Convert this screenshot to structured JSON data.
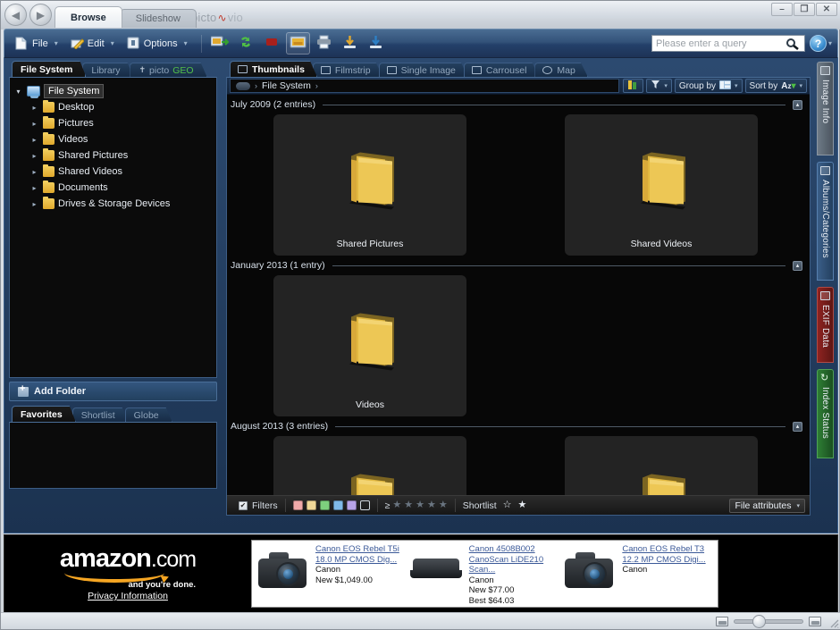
{
  "window": {
    "title": "pictomvio",
    "buttons": {
      "minimize": "–",
      "maximize": "❐",
      "close": "✕"
    }
  },
  "nav": {
    "back": "◀",
    "forward": "▶"
  },
  "app_tabs": [
    {
      "label": "Browse",
      "active": true
    },
    {
      "label": "Slideshow",
      "active": false
    }
  ],
  "brand": {
    "part1": "picto",
    "wave": "\\u223f",
    "part2": "vio"
  },
  "toolbar": {
    "menus": [
      {
        "label": "File",
        "icon": "file-icon",
        "caret": "▾"
      },
      {
        "label": "Edit",
        "icon": "edit-icon",
        "caret": "▾"
      },
      {
        "label": "Options",
        "icon": "options-icon",
        "caret": "▾"
      }
    ],
    "buttons": [
      {
        "name": "export-images-button",
        "icon": "export-images-icon"
      },
      {
        "name": "rotate-button",
        "icon": "rotate-refresh-icon"
      },
      {
        "name": "stop-button",
        "icon": "stop-icon"
      },
      {
        "name": "slideshow-button",
        "icon": "slideshow-icon"
      },
      {
        "name": "print-button",
        "icon": "print-icon"
      },
      {
        "name": "download-button",
        "icon": "download-icon"
      },
      {
        "name": "upload-button",
        "icon": "upload-icon"
      }
    ],
    "search": {
      "placeholder": "Please enter a query",
      "value": "",
      "icon": "search-icon"
    },
    "help": {
      "label": "?",
      "caret": "▾"
    }
  },
  "sidebar": {
    "tabs": [
      {
        "label": "File System",
        "active": true
      },
      {
        "label": "Library",
        "active": false
      },
      {
        "label": "pictoGEO",
        "active": false,
        "geo_suffix": "GEO",
        "prefix": "picto"
      }
    ],
    "tree": [
      {
        "label": "File System",
        "icon": "computer-icon",
        "arrow": "▾",
        "level": 0,
        "selected": true
      },
      {
        "label": "Desktop",
        "icon": "folder-icon",
        "arrow": "▸",
        "level": 1
      },
      {
        "label": "Pictures",
        "icon": "folder-icon",
        "arrow": "▸",
        "level": 1
      },
      {
        "label": "Videos",
        "icon": "folder-icon",
        "arrow": "▸",
        "level": 1
      },
      {
        "label": "Shared Pictures",
        "icon": "folder-icon",
        "arrow": "▸",
        "level": 1
      },
      {
        "label": "Shared Videos",
        "icon": "folder-icon",
        "arrow": "▸",
        "level": 1
      },
      {
        "label": "Documents",
        "icon": "folder-icon",
        "arrow": "▸",
        "level": 1
      },
      {
        "label": "Drives & Storage Devices",
        "icon": "drive-icon",
        "arrow": "▸",
        "level": 1
      }
    ],
    "add_folder": {
      "label": "Add Folder",
      "icon": "add-folder-icon"
    },
    "bottom_tabs": [
      {
        "label": "Favorites",
        "active": true
      },
      {
        "label": "Shortlist",
        "active": false
      },
      {
        "label": "Globe",
        "active": false
      }
    ]
  },
  "view_tabs": [
    {
      "label": "Thumbnails",
      "icon": "grid-icon",
      "active": true
    },
    {
      "label": "Filmstrip",
      "icon": "filmstrip-icon",
      "active": false
    },
    {
      "label": "Single Image",
      "icon": "single-image-icon",
      "active": false
    },
    {
      "label": "Carrousel",
      "icon": "carrousel-icon",
      "active": false
    },
    {
      "label": "Map",
      "icon": "map-icon",
      "active": false
    }
  ],
  "breadcrumb": {
    "icon": "cloud-icon",
    "sep": "›",
    "path": [
      "File System"
    ],
    "trailing_sep": "›"
  },
  "view_controls": [
    {
      "name": "filter-color-button",
      "label": "",
      "icon": "color-filter-icon",
      "caret": ""
    },
    {
      "name": "filter-button",
      "label": "",
      "icon": "funnel-icon",
      "caret": "▾"
    },
    {
      "name": "group-by-button",
      "label": "Group by",
      "icon": "group-icon",
      "caret": "▾"
    },
    {
      "name": "sort-by-button",
      "label": "Sort by",
      "icon": "az-sort-icon",
      "caret": "▾"
    }
  ],
  "groups": [
    {
      "title": "July 2009 (2 entries)",
      "collapse": "▴",
      "items": [
        {
          "label": "Shared Pictures",
          "icon": "folder-thumb-icon"
        },
        {
          "label": "Shared Videos",
          "icon": "folder-thumb-icon"
        }
      ]
    },
    {
      "title": "January 2013 (1 entry)",
      "collapse": "▴",
      "items": [
        {
          "label": "Videos",
          "icon": "folder-thumb-icon"
        }
      ]
    },
    {
      "title": "August 2013 (3 entries)",
      "collapse": "▴",
      "items": [
        {
          "label": "",
          "icon": "folder-thumb-icon"
        },
        {
          "label": "",
          "icon": "folder-thumb-icon"
        }
      ]
    }
  ],
  "filter_bar": {
    "filters_label": "Filters",
    "filters_checked": "✔",
    "colors": [
      "#f0a9a9",
      "#f0d898",
      "#7dd07d",
      "#7fb9e8",
      "#b7a3e8",
      "transparent"
    ],
    "rating": {
      "operator": "≥",
      "stars": 5,
      "filled": 0,
      "glyph": "★"
    },
    "shortlist_label": "Shortlist",
    "shortlist_icons": [
      "☆",
      "★"
    ],
    "file_attributes": {
      "label": "File attributes",
      "caret": "▾"
    }
  },
  "right_rail": [
    {
      "label": "Image Info",
      "style": "grey",
      "icon": "info-panel-icon"
    },
    {
      "label": "Albums/Categories",
      "style": "blue",
      "icon": "albums-icon"
    },
    {
      "label": "EXIF Data",
      "style": "red",
      "icon": "exif-icon"
    },
    {
      "label": "Index Status",
      "style": "green",
      "icon": "index-status-icon"
    }
  ],
  "ad": {
    "amazon": {
      "wordmark": "amazon",
      "suffix": ".com",
      "tagline": "and you're done.",
      "privacy_link": "Privacy Information"
    },
    "products": [
      {
        "image": "camera-icon",
        "title_lines": [
          "Canon EOS Rebel T5i",
          "18.0 MP CMOS Dig..."
        ],
        "brand": "Canon",
        "prices": [
          "New $1,049.00"
        ]
      },
      {
        "image": "scanner-icon",
        "title_lines": [
          "Canon 4508B002",
          "CanoScan LiDE210",
          "Scan..."
        ],
        "brand": "Canon",
        "prices": [
          "New $77.00",
          "Best $64.03"
        ]
      },
      {
        "image": "camera-icon",
        "title_lines": [
          "Canon EOS Rebel T3",
          "12.2 MP CMOS Digi..."
        ],
        "brand": "Canon",
        "prices": []
      }
    ]
  },
  "status_bar": {
    "zoom_small_icon": "small-thumb-icon",
    "zoom_large_icon": "large-thumb-icon",
    "zoom_value": 25
  }
}
